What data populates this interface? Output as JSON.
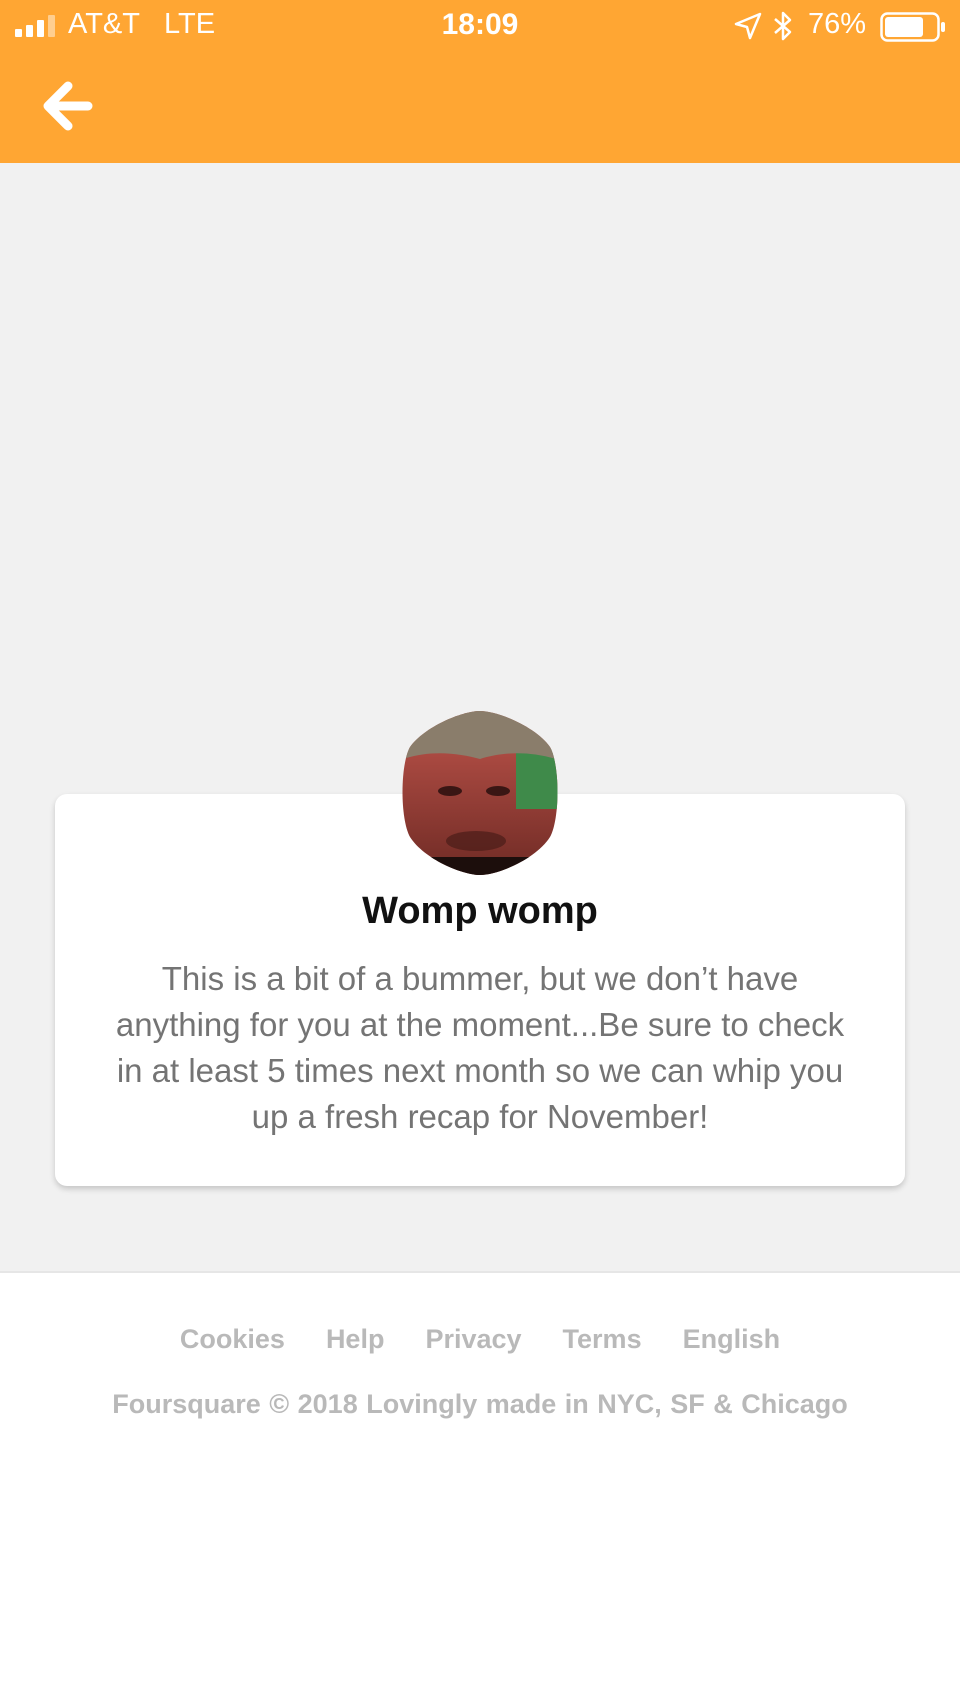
{
  "status_bar": {
    "carrier": "AT&T",
    "network": "LTE",
    "time": "18:09",
    "battery_percent": "76%",
    "battery_level": 0.76,
    "icons": [
      "signal-icon",
      "location-arrow-icon",
      "bluetooth-icon",
      "battery-icon"
    ]
  },
  "header": {
    "back_icon": "back-arrow-icon",
    "accent_color": "#ffa633"
  },
  "card": {
    "title": "Womp womp",
    "body": "This is a bit of a bummer, but we don’t have anything for you at the moment...Be sure to check in at least 5 times next month so we can whip you up a fresh recap for November!"
  },
  "footer": {
    "links": [
      {
        "label": "Cookies"
      },
      {
        "label": "Help"
      },
      {
        "label": "Privacy"
      },
      {
        "label": "Terms"
      },
      {
        "label": "English"
      }
    ],
    "copyright": "Foursquare © 2018  Lovingly made in NYC, SF & Chicago"
  }
}
